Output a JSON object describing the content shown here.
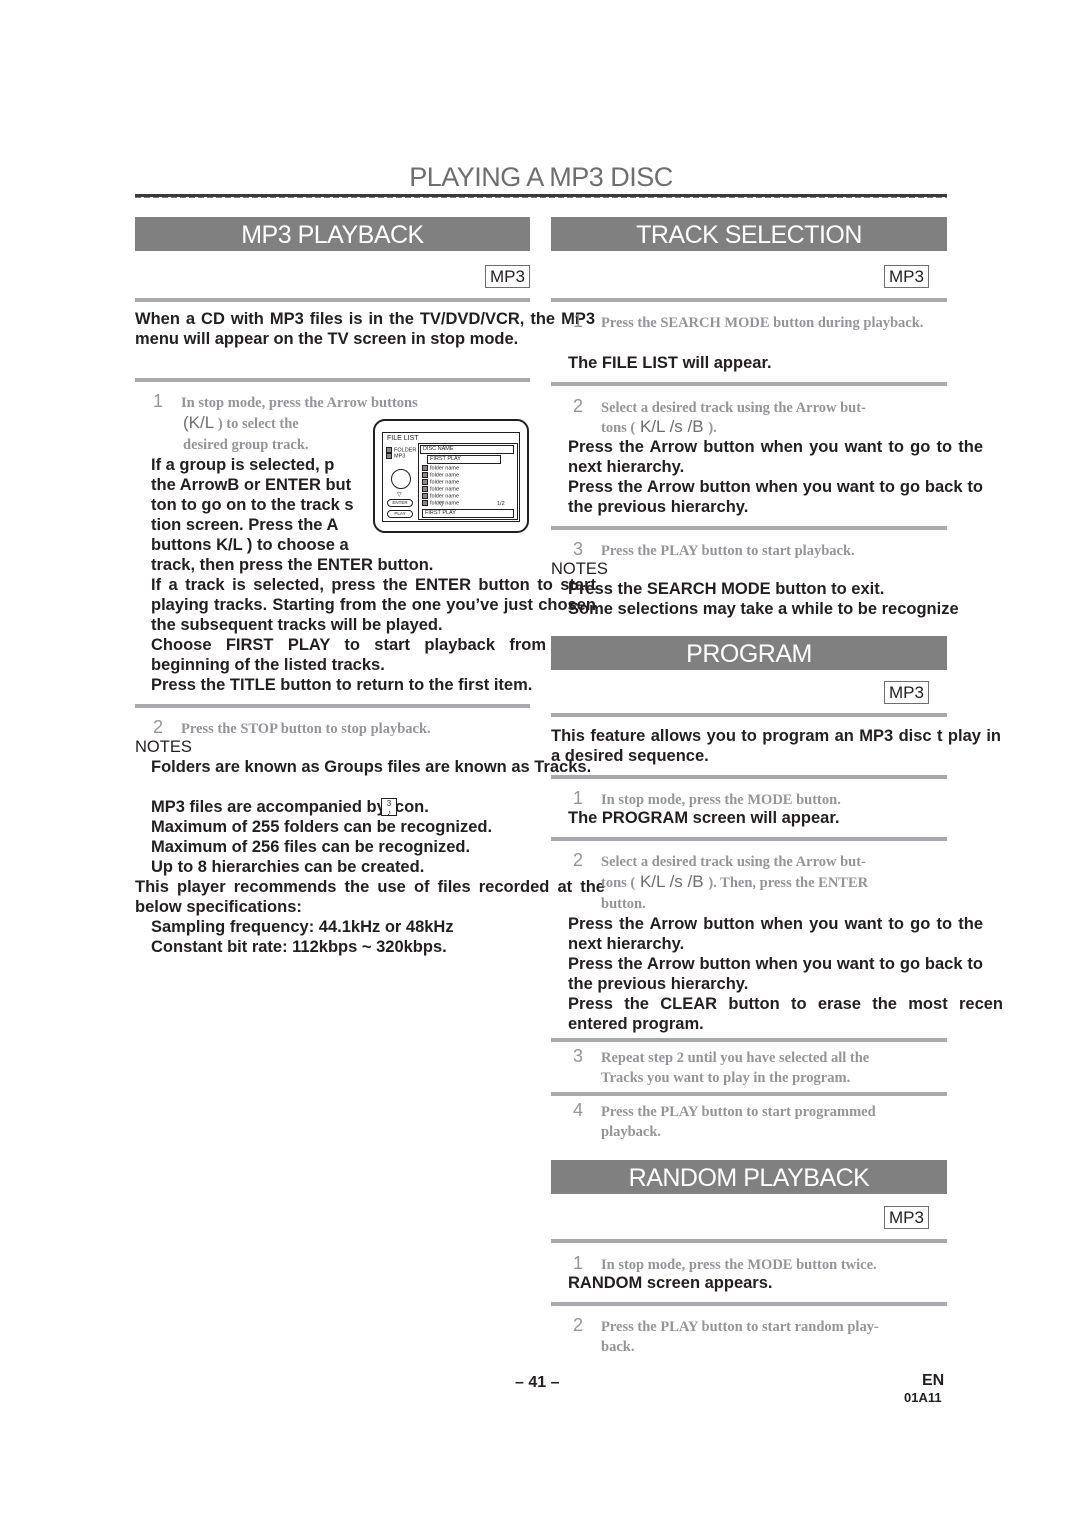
{
  "page": {
    "title": "PLAYING A MP3 DISC",
    "page_number": "– 41 –",
    "language": "EN",
    "code": "01A11"
  },
  "mp3_playback": {
    "heading": "MP3 PLAYBACK",
    "badge": "MP3",
    "intro": "When a CD with MP3 files is in the TV/DVD/VCR, the MP3 menu will appear on the TV screen in stop mode.",
    "step1": {
      "num": "1",
      "text_a": "In stop mode, press the Arrow buttons",
      "arrows": "(K/L",
      "text_b": ") to select the",
      "text_c": "desired group track."
    },
    "step1_body": [
      "If a group is selected, p",
      "the ArrowB  or ENTER but",
      "ton to go on to the track s",
      "tion screen. Press the A",
      "buttons K/L )  to  choose  a",
      "track, then press the ENTER button."
    ],
    "step1_more": [
      "If a track is selected, press the ENTER button to start playing tracks. Starting from the one you’ve just chosen the subsequent tracks will be played.",
      "Choose FIRST PLAY to start playback from beginning of the listed tracks.",
      "Press the TITLE button to return to the first item."
    ],
    "step2": {
      "num": "2",
      "text": "Press the STOP button to stop playback."
    },
    "notes_label": "NOTES",
    "notes": [
      "Folders are known as Groups  files are known as Tracks.",
      "MP3 files are accompanied by      icon.",
      "Maximum of 255 folders can be recognized.",
      "Maximum of 256 files can be recognized.",
      "Up to 8 hierarchies can be created."
    ],
    "recommend": "This player recommends the use of files recorded at the below specifications:",
    "specs": [
      "Sampling frequency: 44.1kHz or 48kHz",
      "Constant bit rate: 112kbps ~ 320kbps."
    ],
    "mp3_icon_label": "3",
    "screen": {
      "title": "FILE LIST",
      "legend": [
        "FOLDER",
        "MP3"
      ],
      "disc_name": "DISC NAME",
      "first_play": "FIRST PLAY",
      "folders": [
        "folder name",
        "folder name",
        "folder name",
        "folder name",
        "folder name",
        "folder name"
      ],
      "page": "1/2",
      "bottom": "FIRST PLAY",
      "enter_btn": "ENTER",
      "play_btn": "PLAY"
    }
  },
  "track_selection": {
    "heading": "TRACK SELECTION",
    "badge": "MP3",
    "step1": {
      "num": "1",
      "text": "Press the SEARCH MODE button during playback."
    },
    "step1_result": "The FILE LIST will appear.",
    "step2": {
      "num": "2",
      "text_a": "Select a desired track using the Arrow but-",
      "text_b": "tons (",
      "arrows": " K/L /s  /B ",
      "text_c": ")."
    },
    "step2_body": [
      "Press the Arrow button when you want to go to the next hierarchy.",
      "Press the Arrow button when you want to go back to the previous hierarchy."
    ],
    "step3": {
      "num": "3",
      "text": "Press the PLAY button to start playback."
    },
    "notes_label": "NOTES",
    "notes": [
      "Press the SEARCH MODE button to exit.",
      "Some selections may take a while to be recognize"
    ]
  },
  "program": {
    "heading": "PROGRAM",
    "badge": "MP3",
    "intro": "This feature allows you to program an MP3 disc t play in a desired sequence.",
    "step1": {
      "num": "1",
      "text": "In stop mode, press the MODE button."
    },
    "step1_result": "The PROGRAM screen will appear.",
    "step2": {
      "num": "2",
      "text_a": "Select a desired track using the Arrow but-",
      "text_b": "tons (",
      "arrows": " K/L /s  /B ",
      "text_c": ").  Then, press the ENTER",
      "text_d": "button."
    },
    "step2_body": [
      "Press the Arrow button when you want to go to the next hierarchy.",
      "Press the Arrow button when you want to go back to the previous hierarchy.",
      "Press the CLEAR button to erase the most recen entered program."
    ],
    "step3": {
      "num": "3",
      "text_a": "Repeat step 2 until you have selected all the",
      "text_b": "Tracks you want to play in the program."
    },
    "step4": {
      "num": "4",
      "text_a": "Press the PLAY button to start programmed",
      "text_b": "playback."
    }
  },
  "random_playback": {
    "heading": "RANDOM PLAYBACK",
    "badge": "MP3",
    "step1": {
      "num": "1",
      "text": "In stop mode, press the MODE button twice."
    },
    "step1_result": "RANDOM screen appears.",
    "step2": {
      "num": "2",
      "text_a": "Press the PLAY button to start random play-",
      "text_b": "back."
    }
  }
}
